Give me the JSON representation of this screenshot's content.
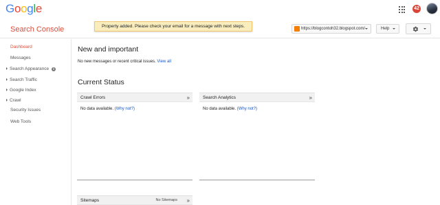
{
  "header": {
    "logo_letters": [
      {
        "ch": "G",
        "color": "#4285f4"
      },
      {
        "ch": "o",
        "color": "#ea4335"
      },
      {
        "ch": "o",
        "color": "#fbbc05"
      },
      {
        "ch": "g",
        "color": "#4285f4"
      },
      {
        "ch": "l",
        "color": "#34a853"
      },
      {
        "ch": "e",
        "color": "#ea4335"
      }
    ],
    "notification_count": "42"
  },
  "subbar": {
    "product_name": "Search Console",
    "toast_message": "Property added. Please check your email for a message with next steps.",
    "site_url": "https://blogcontoh32.blogspot.com/",
    "help_label": "Help"
  },
  "sidebar": {
    "items": [
      {
        "label": "Dashboard",
        "active": true,
        "expandable": false
      },
      {
        "label": "Messages",
        "active": false,
        "expandable": false
      },
      {
        "label": "Search Appearance",
        "active": false,
        "expandable": true,
        "info": true
      },
      {
        "label": "Search Traffic",
        "active": false,
        "expandable": true
      },
      {
        "label": "Google Index",
        "active": false,
        "expandable": true
      },
      {
        "label": "Crawl",
        "active": false,
        "expandable": true
      },
      {
        "label": "Security Issues",
        "active": false,
        "expandable": false
      },
      {
        "label": "Web Tools",
        "active": false,
        "expandable": false
      }
    ]
  },
  "main": {
    "new_important_title": "New and important",
    "messages_text": "No new messages or recent critical issues.",
    "view_all_link": "View all",
    "current_status_title": "Current Status",
    "cards": {
      "crawl_errors": {
        "title": "Crawl Errors",
        "body": "No data available.",
        "link": "(Why not?)",
        "arrows": "»"
      },
      "search_analytics": {
        "title": "Search Analytics",
        "body": "No data available.",
        "link": "(Why not?)",
        "arrows": "»"
      },
      "sitemaps": {
        "title": "Sitemaps",
        "note": "No Sitemaps",
        "arrows": "»"
      }
    }
  },
  "colors": {
    "accent_red": "#dd4b39",
    "link_blue": "#1155cc",
    "toast_bg": "#f9edbe"
  }
}
